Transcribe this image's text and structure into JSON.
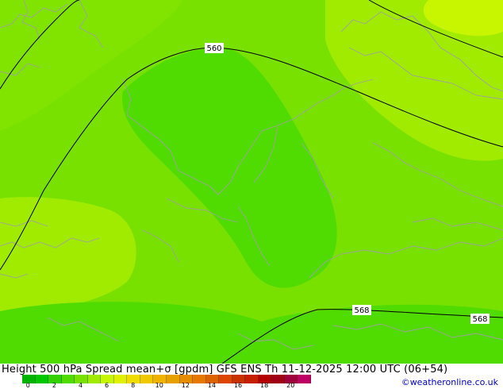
{
  "map": {
    "contours": [
      {
        "label": "560"
      },
      {
        "label": "568"
      },
      {
        "label": "568"
      }
    ],
    "colors": {
      "spread_0_2": "#00c800",
      "spread_2_3": "#32d200",
      "spread_3_4": "#78e100",
      "spread_4_5": "#a0eb00",
      "spread_5_6": "#c8f500",
      "contour_line": "#000000",
      "borders": "#a0a0a0"
    }
  },
  "footer": {
    "title": "Height 500 hPa Spread mean+σ [gpdm] GFS ENS Th 11-12-2025 12:00 UTC (06+54)",
    "credit": "©weatheronline.co.uk"
  },
  "colorbar": {
    "colors": [
      "#00b400",
      "#00c800",
      "#32d200",
      "#50dc00",
      "#78e100",
      "#a0eb00",
      "#c8f500",
      "#e1f000",
      "#f0dc00",
      "#f0c800",
      "#f0b400",
      "#e6a000",
      "#e68c00",
      "#e67800",
      "#dc6400",
      "#dc4600",
      "#c83200",
      "#c81e00",
      "#b40000",
      "#a00014",
      "#a0003c",
      "#be0064"
    ],
    "ticks": [
      "0",
      "2",
      "4",
      "6",
      "8",
      "10",
      "12",
      "14",
      "16",
      "18",
      "20"
    ]
  }
}
